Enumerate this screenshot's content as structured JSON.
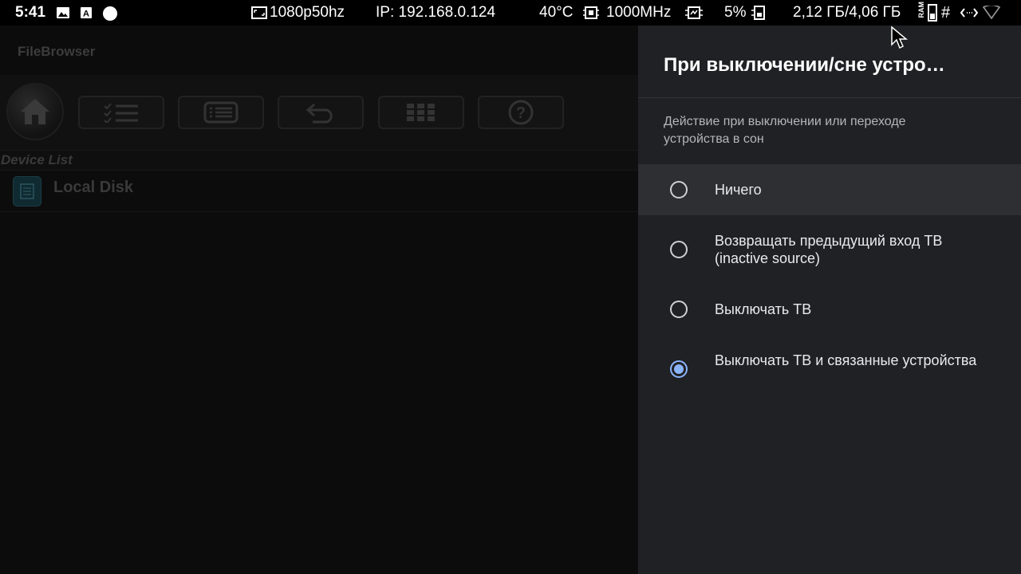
{
  "statusbar": {
    "time": "5:41",
    "resolution": "1080p50hz",
    "ip": "IP: 192.168.0.124",
    "temperature": "40°C",
    "cpu_freq": "1000MHz",
    "cpu_load": "5%",
    "ram": "2,12 ГБ/4,06 ГБ",
    "ram_badge": "RAM",
    "hash": "#",
    "icons": [
      "image-icon",
      "a-badge-icon",
      "circle-icon",
      "display-icon",
      "cpu-temp-icon",
      "cpu-freq-icon",
      "cpu-load-icon",
      "ram-icon",
      "swap-arrows-icon",
      "wifi-icon"
    ]
  },
  "app": {
    "title": "FileBrowser",
    "toolbar": [
      "home-icon",
      "checklist-icon",
      "list-icon",
      "back-icon",
      "grid-icon",
      "help-icon"
    ],
    "device_list_header": "Device List",
    "devices": [
      {
        "label": "Local Disk",
        "icon": "disk-icon"
      }
    ]
  },
  "panel": {
    "title": "При выключении/сне устро…",
    "description": "Действие при выключении или переходе устройства в сон",
    "options": [
      {
        "label": "Ничего",
        "checked": false,
        "focused": true
      },
      {
        "label": "Возвращать предыдущий вход ТВ (inactive source)",
        "checked": false,
        "focused": false
      },
      {
        "label": "Выключать ТВ",
        "checked": false,
        "focused": false
      },
      {
        "label": "Выключать ТВ и связанные устройства",
        "checked": true,
        "focused": false
      }
    ],
    "accent_color": "#8ab4f8"
  }
}
